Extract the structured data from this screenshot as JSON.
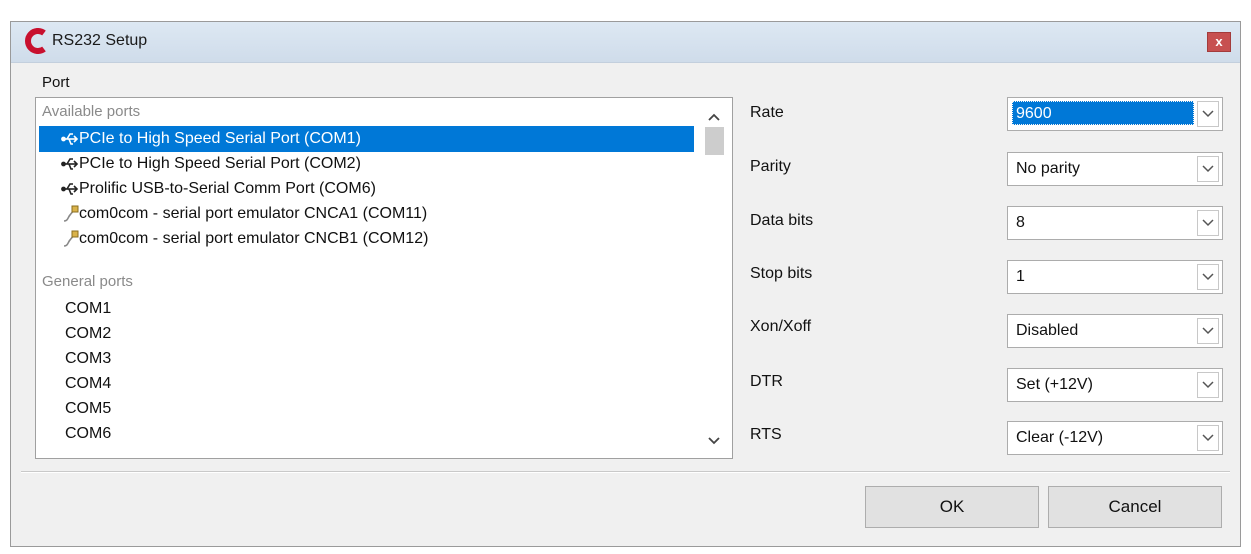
{
  "window": {
    "title": "RS232 Setup",
    "close_label": "x"
  },
  "port": {
    "label": "Port",
    "available_header": "Available ports",
    "available_ports": [
      {
        "label": "PCIe to High Speed Serial Port (COM1)",
        "icon": "usb-icon",
        "selected": true
      },
      {
        "label": "PCIe to High Speed Serial Port (COM2)",
        "icon": "usb-icon"
      },
      {
        "label": "Prolific USB-to-Serial Comm Port (COM6)",
        "icon": "usb-icon"
      },
      {
        "label": "com0com - serial port emulator CNCA1 (COM11)",
        "icon": "serial-cable-icon"
      },
      {
        "label": "com0com - serial port emulator CNCB1 (COM12)",
        "icon": "serial-cable-icon"
      }
    ],
    "general_header": "General ports",
    "general_ports": [
      "COM1",
      "COM2",
      "COM3",
      "COM4",
      "COM5",
      "COM6"
    ]
  },
  "settings": {
    "rate": {
      "label": "Rate",
      "value": "9600"
    },
    "parity": {
      "label": "Parity",
      "value": "No parity"
    },
    "data_bits": {
      "label": "Data bits",
      "value": "8"
    },
    "stop_bits": {
      "label": "Stop bits",
      "value": "1"
    },
    "xon_xoff": {
      "label": "Xon/Xoff",
      "value": "Disabled"
    },
    "dtr": {
      "label": "DTR",
      "value": "Set (+12V)"
    },
    "rts": {
      "label": "RTS",
      "value": "Clear (-12V)"
    }
  },
  "buttons": {
    "ok": "OK",
    "cancel": "Cancel"
  },
  "colors": {
    "selection": "#0078d7",
    "close": "#c75050",
    "logo": "#c8102e"
  }
}
